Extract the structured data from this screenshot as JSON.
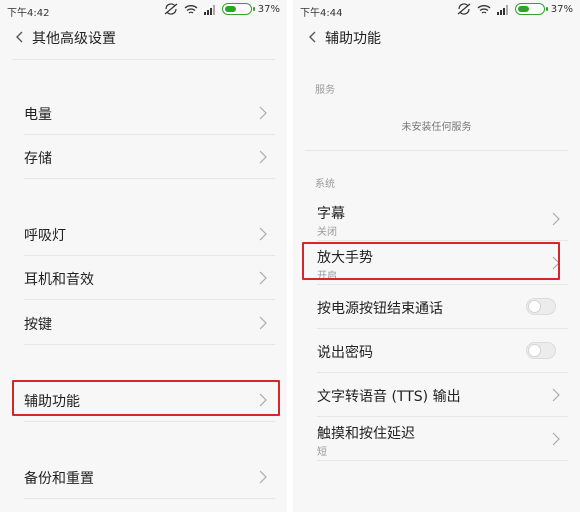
{
  "left": {
    "status": {
      "time": "下午4:42",
      "battery_pct": "37%"
    },
    "title": "其他高级设置",
    "items": [
      {
        "label": "电量"
      },
      {
        "label": "存储"
      },
      {
        "label": "呼吸灯"
      },
      {
        "label": "耳机和音效"
      },
      {
        "label": "按键"
      },
      {
        "label": "辅助功能"
      },
      {
        "label": "备份和重置"
      }
    ]
  },
  "right": {
    "status": {
      "time": "下午4:44",
      "battery_pct": "37%"
    },
    "title": "辅助功能",
    "services_header": "服务",
    "services_empty": "未安装任何服务",
    "system_header": "系统",
    "items": [
      {
        "label": "字幕",
        "sub": "关闭"
      },
      {
        "label": "放大手势",
        "sub": "开启"
      },
      {
        "label": "按电源按钮结束通话",
        "toggle": false
      },
      {
        "label": "说出密码",
        "toggle": false
      },
      {
        "label": "文字转语音 (TTS) 输出"
      },
      {
        "label": "触摸和按住延迟",
        "sub": "短"
      }
    ]
  },
  "colors": {
    "highlight": "#d4262b",
    "battery": "#2aa52a"
  },
  "icons": [
    "back-arrow-icon",
    "chevron-right-icon",
    "sync-off-icon",
    "wifi-icon",
    "signal-icon",
    "battery-icon"
  ]
}
